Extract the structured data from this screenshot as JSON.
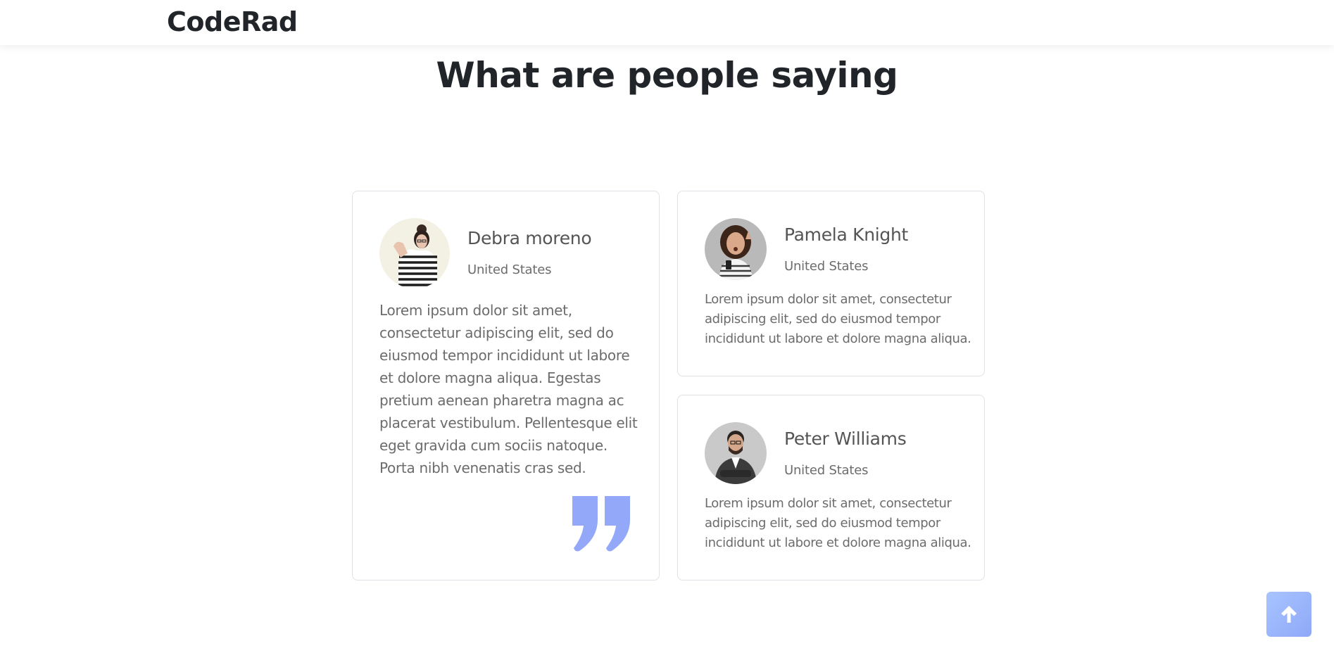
{
  "navbar": {
    "brand": "CodeRad"
  },
  "section": {
    "title": "What are people saying"
  },
  "testimonials": [
    {
      "name": "Debra moreno",
      "location": "United States",
      "text": "Lorem ipsum dolor sit amet, consectetur adipiscing elit, sed do eiusmod tempor incididunt ut labore et dolore magna aliqua. Egestas pretium aenean pharetra magna ac placerat vestibulum. Pellentesque elit eget gravida cum sociis natoque. Porta nibh venenatis cras sed."
    },
    {
      "name": "Pamela Knight",
      "location": "United States",
      "text": "Lorem ipsum dolor sit amet, consectetur adipiscing elit, sed do eiusmod tempor incididunt ut labore et dolore magna aliqua."
    },
    {
      "name": "Peter Williams",
      "location": "United States",
      "text": "Lorem ipsum dolor sit amet, consectetur adipiscing elit, sed do eiusmod tempor incididunt ut labore et dolore magna aliqua."
    }
  ],
  "icons": {
    "quote": "quote-icon",
    "scroll_top": "arrow-up-icon"
  },
  "colors": {
    "accent": "#93a8f8",
    "heading": "#212529",
    "text": "#6c6c6c",
    "border": "#dee2e6"
  }
}
